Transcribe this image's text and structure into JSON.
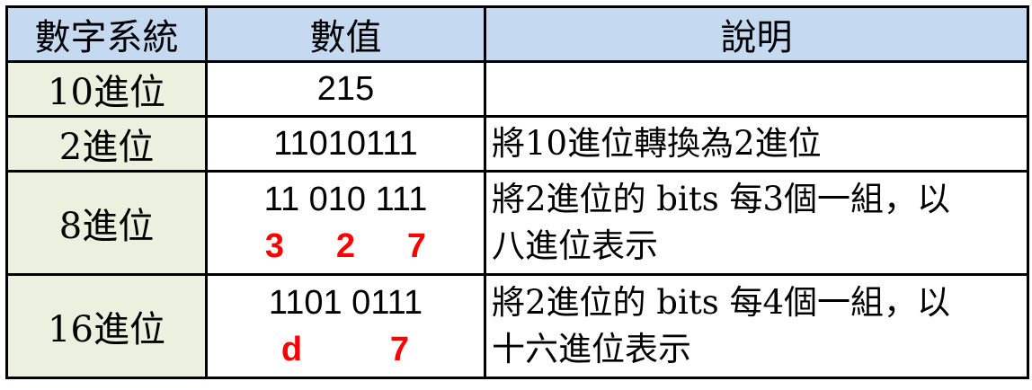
{
  "headers": {
    "system": "數字系統",
    "value": "數值",
    "description": "說明"
  },
  "rows": [
    {
      "system": "10進位",
      "value_lines": [
        "215"
      ],
      "digits": [],
      "description": ""
    },
    {
      "system": "2進位",
      "value_lines": [
        "11010111"
      ],
      "digits": [],
      "description": "將10進位轉換為2進位"
    },
    {
      "system": "8進位",
      "value_lines": [
        "11 010 111"
      ],
      "digits": [
        "3",
        "2",
        "7"
      ],
      "description_line1": "將2進位的 bits 每3個一組，以",
      "description_line2": "八進位表示"
    },
    {
      "system": "16進位",
      "value_lines": [
        "1101 0111"
      ],
      "digits": [
        "d",
        "7"
      ],
      "description_line1": "將2進位的 bits 每4個一組，以",
      "description_line2": "十六進位表示"
    }
  ],
  "colors": {
    "header_bg": "#c5d9f1",
    "system_bg": "#ebf1de",
    "highlight_digit": "#ff0000",
    "border": "#000000"
  }
}
